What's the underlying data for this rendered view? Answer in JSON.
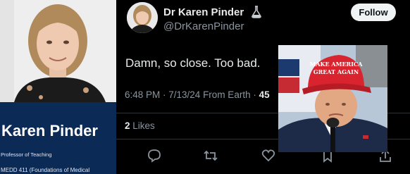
{
  "profile_card": {
    "name": "Karen Pinder",
    "role": "Professor of Teaching",
    "course": "MEDD 411 (Foundations of Medical"
  },
  "tweet": {
    "display_name": "Dr Karen Pinder",
    "handle": "@DrKarenPinder",
    "follow_label": "Follow",
    "text": "Damn, so close. Too bad.",
    "timestamp": "6:48 PM · 7/13/24 From Earth ·",
    "views_partial": "45",
    "likes_count": "2",
    "likes_label": "Likes"
  },
  "inset_photo": {
    "hat_text_line1": "MAKE AMERICA",
    "hat_text_line2": "GREAT AGAIN",
    "hat_color": "#d9232e"
  },
  "icons": [
    "flask-icon",
    "reply-icon",
    "retweet-icon",
    "like-icon",
    "bookmark-icon",
    "share-icon"
  ],
  "colors": {
    "background": "#000000",
    "profile_card_bg": "#0c2a56",
    "follow_button_bg": "#eff3f4",
    "muted_text": "#8b949e"
  }
}
